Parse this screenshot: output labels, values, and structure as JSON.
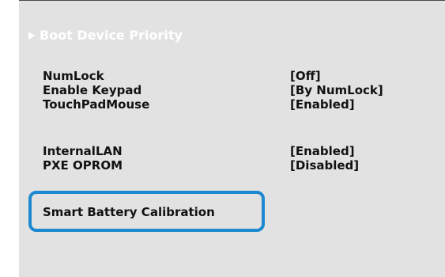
{
  "menu": {
    "boot_device_priority": "Boot Device Priority",
    "arrow_icon": "triangle-right-icon"
  },
  "settings": [
    {
      "label": "NumLock",
      "value": "[Off]"
    },
    {
      "label": "Enable Keypad",
      "value": "[By NumLock]"
    },
    {
      "label": "TouchPadMouse",
      "value": "[Enabled]"
    },
    {
      "label": "InternalLAN",
      "value": "[Enabled]"
    },
    {
      "label": "PXE OPROM",
      "value": "[Disabled]"
    }
  ],
  "selected": {
    "label": "Smart Battery Calibration"
  },
  "colors": {
    "panel_bg": "#e2e2e2",
    "highlight_border": "#1e88d0",
    "text": "#111111",
    "menu_text": "#ffffff"
  }
}
